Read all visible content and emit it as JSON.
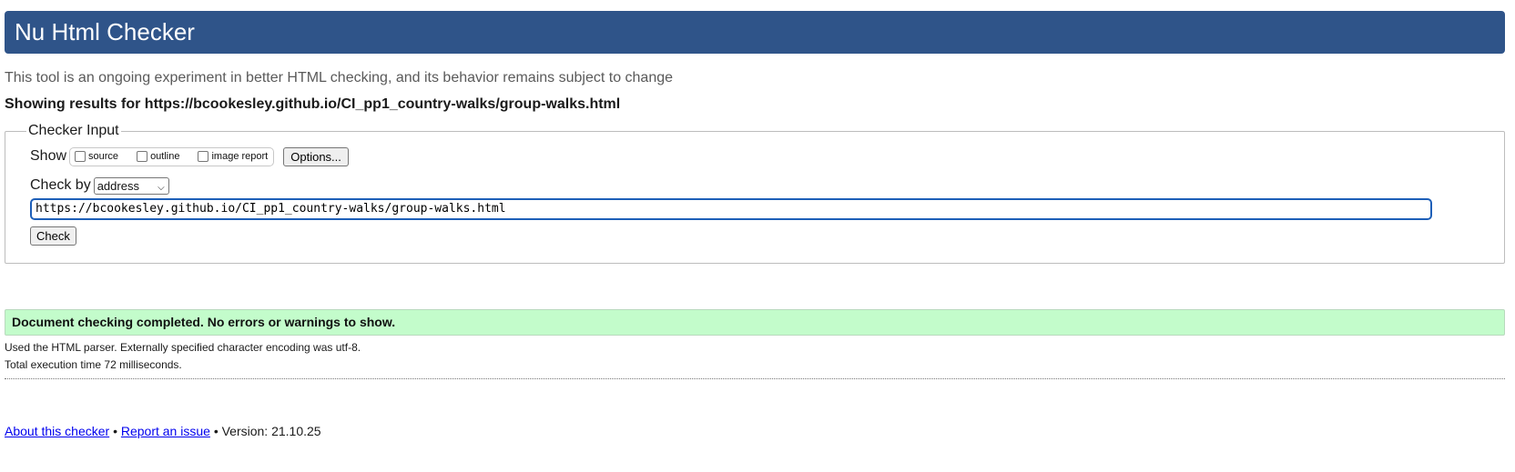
{
  "header": {
    "title": "Nu Html Checker"
  },
  "intro": {
    "subtitle": "This tool is an ongoing experiment in better HTML checking, and its behavior remains subject to change",
    "results_for": "Showing results for https://bcookesley.github.io/CI_pp1_country-walks/group-walks.html"
  },
  "checker_input": {
    "legend": "Checker Input",
    "show_label": "Show",
    "show_options": [
      {
        "label": "source",
        "checked": false
      },
      {
        "label": "outline",
        "checked": false
      },
      {
        "label": "image report",
        "checked": false
      }
    ],
    "options_button": "Options...",
    "check_by_label": "Check by",
    "check_by_selected": "address",
    "url_value": "https://bcookesley.github.io/CI_pp1_country-walks/group-walks.html",
    "check_button": "Check"
  },
  "result": {
    "message": "Document checking completed. No errors or warnings to show.",
    "parser_info": "Used the HTML parser. Externally specified character encoding was utf-8.",
    "execution_time": "Total execution time 72 milliseconds.",
    "success_color": "#c3fccb"
  },
  "footer": {
    "about_link": "About this checker",
    "separator": "•",
    "report_link": "Report an issue",
    "version_text": "Version: 21.10.25"
  },
  "colors": {
    "header_bg": "#2f5489",
    "input_focus": "#1d5fb8",
    "link": "#0000ee"
  }
}
